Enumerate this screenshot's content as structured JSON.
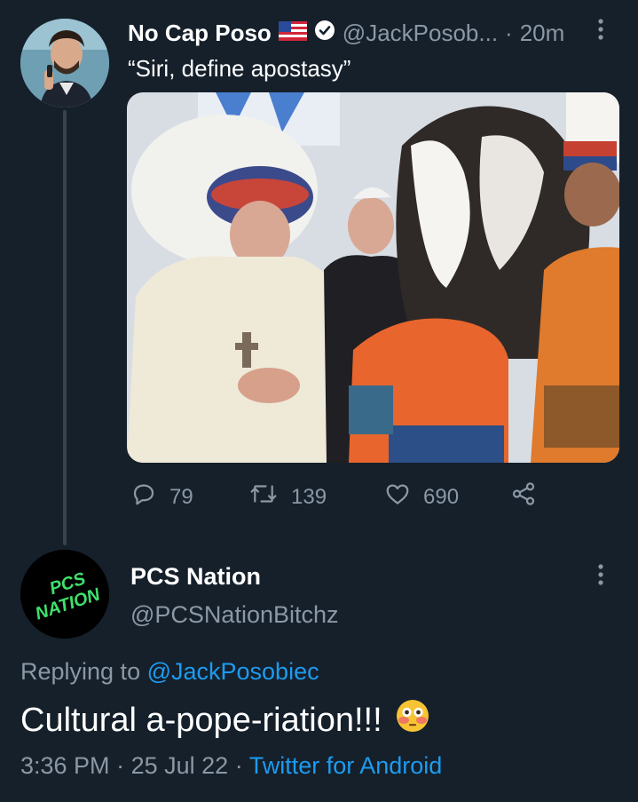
{
  "tweet": {
    "author_name": "No Cap Poso",
    "flag_icon": "us-flag-icon",
    "handle": "@JackPosob...",
    "separator": "·",
    "time": "20m",
    "text": "“Siri, define apostasy”",
    "actions": {
      "replies": "79",
      "retweets": "139",
      "likes": "690"
    }
  },
  "reply": {
    "author_name": "PCS Nation",
    "handle": "@PCSNationBitchz",
    "avatar_text_line1": "PCS",
    "avatar_text_line2": "NATION",
    "replying_prefix": "Replying to ",
    "replying_handle": "@JackPosobiec",
    "text": "Cultural a-pope-riation!!!",
    "time": "3:36 PM",
    "date": "25 Jul 22",
    "separator": "·",
    "source": "Twitter for Android"
  },
  "colors": {
    "background": "#15202b",
    "secondary_text": "#8b98a5",
    "link": "#1d9bf0",
    "avatar_text": "#3fe06a"
  }
}
